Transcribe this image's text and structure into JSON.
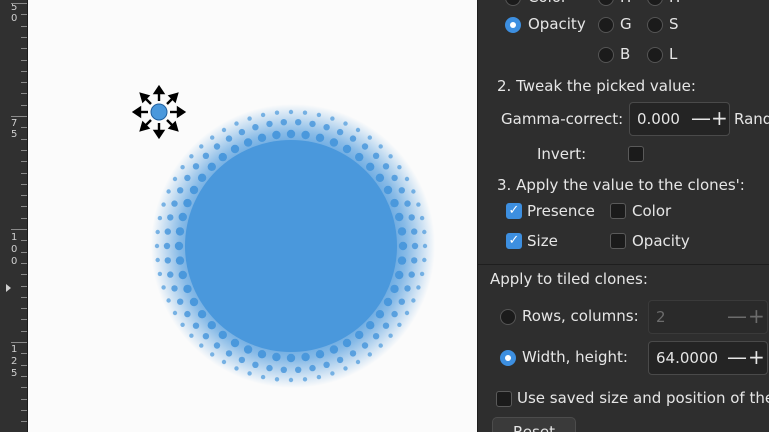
{
  "ruler": {
    "digits": [
      "5",
      "0",
      "7",
      "5",
      "1",
      "0",
      "0",
      "1",
      "2",
      "5"
    ]
  },
  "canvas": {
    "accent": "#4a98dc",
    "tool_icon": "transform-arrows-icon"
  },
  "panel": {
    "top_clipped": {
      "color": "Color",
      "h": "H",
      "hh": "H"
    },
    "pick": {
      "opacity": "Opacity",
      "g": "G",
      "s": "S",
      "b": "B",
      "l": "L"
    },
    "tweak": {
      "heading": "2. Tweak the picked value:",
      "gamma_label": "Gamma-correct:",
      "gamma_value": "0.000",
      "rand_label": "Rand",
      "invert_label": "Invert:"
    },
    "apply": {
      "heading": "3. Apply the value to the clones':",
      "presence": "Presence",
      "color": "Color",
      "size": "Size",
      "opacity": "Opacity"
    },
    "tiled": {
      "heading": "Apply to tiled clones:",
      "rows_cols_label": "Rows, columns:",
      "rows_cols_value": "2",
      "width_height_label": "Width, height:",
      "width_height_value": "64.0000",
      "use_saved_label": "Use saved size and position of the tile",
      "reset_label": "Reset"
    },
    "spin_plus": "+",
    "spin_minus": "—",
    "checkmark": "✓"
  }
}
